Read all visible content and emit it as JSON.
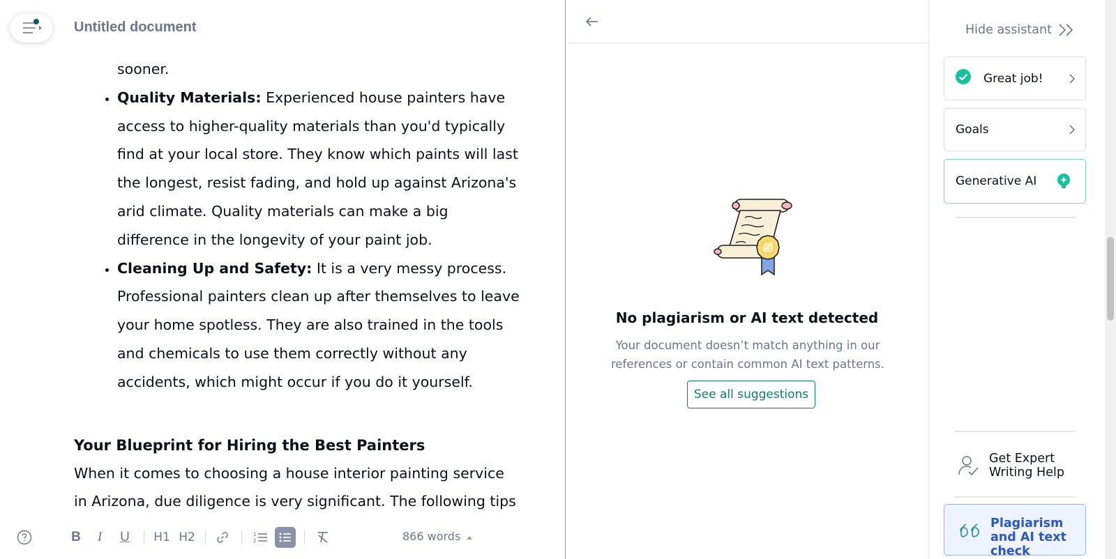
{
  "editor": {
    "title": "Untitled document",
    "continuation_text": "sooner.",
    "bullets": [
      {
        "bold": "Quality Materials:",
        "text": " Experienced house painters have access to higher-quality materials than you'd typically find at your local store. They know which paints will last the longest, resist fading, and hold up against Arizona's arid climate. Quality materials can make a big difference in the longevity of your paint job."
      },
      {
        "bold": "Cleaning Up and Safety:",
        "text": " It is a very messy process. Professional painters clean up after themselves to leave your home spotless. They are also trained in the tools and chemicals to use them correctly without any accidents, which might occur if you do it yourself."
      }
    ],
    "heading": "Your Blueprint for Hiring the Best Painters",
    "paragraph": "When it comes to choosing a house interior painting service in Arizona, due diligence is very significant. The following tips"
  },
  "toolbar": {
    "bold": "B",
    "italic": "I",
    "underline": "U",
    "h1": "H1",
    "h2": "H2",
    "word_count": "866 words"
  },
  "panel": {
    "result_title": "No plagiarism or AI text detected",
    "result_description": "Your document doesn’t match anything in our references or contain common AI text patterns.",
    "see_all_button": "See all suggestions"
  },
  "sidebar": {
    "hide_assistant": "Hide assistant",
    "cards": {
      "great_job": "Great job!",
      "goals": "Goals",
      "generative_ai": "Generative AI"
    },
    "expert_help": "Get Expert Writing Help",
    "plagiarism_check": "Plagiarism and AI text check"
  },
  "colors": {
    "accent_green": "#15c39a",
    "teal": "#0f7c6c",
    "blue_active": "#2d55c6",
    "muted_text": "#6d758d"
  },
  "icons": [
    "menu-icon",
    "help-icon",
    "link-icon",
    "numbered-list-icon",
    "bulleted-list-icon",
    "clear-format-icon",
    "back-arrow-icon",
    "double-chevron-right-icon",
    "check-circle-icon",
    "chevron-right-icon",
    "bulb-icon",
    "expert-icon",
    "quote-icon",
    "certificate-scroll-icon"
  ]
}
